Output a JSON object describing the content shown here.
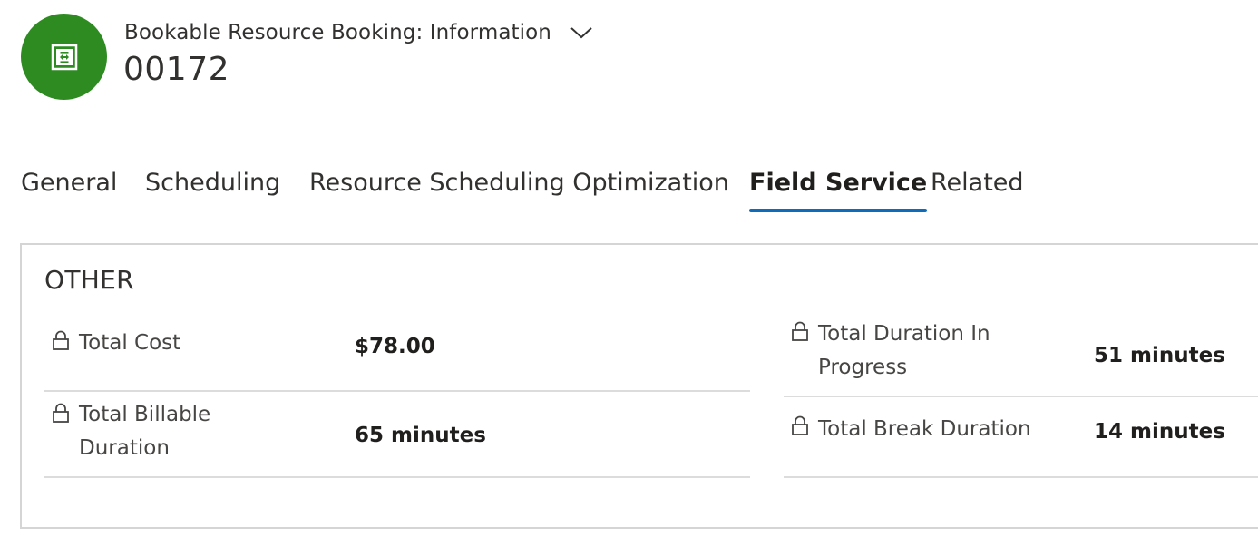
{
  "header": {
    "form_name": "Bookable Resource Booking: Information",
    "record_title": "00172",
    "entity_icon": "bookable-resource-booking-icon",
    "avatar_color": "#2e8b22",
    "form_selector_icon": "chevron-down-icon"
  },
  "tabs": [
    {
      "label": "General",
      "active": false
    },
    {
      "label": "Scheduling",
      "active": false
    },
    {
      "label": "Resource Scheduling Optimization",
      "active": false
    },
    {
      "label": "Field Service",
      "active": true
    },
    {
      "label": "Related",
      "active": false
    }
  ],
  "accent_color": "#0f6cbd",
  "section": {
    "title": "OTHER",
    "fields": [
      {
        "label": "Total Cost",
        "value": "$78.00",
        "locked": true
      },
      {
        "label": "Total Billable Duration",
        "value": "65 minutes",
        "locked": true
      },
      {
        "label": "Total Duration In Progress",
        "value": "51 minutes",
        "locked": true
      },
      {
        "label": "Total Break Duration",
        "value": "14 minutes",
        "locked": true
      }
    ]
  }
}
